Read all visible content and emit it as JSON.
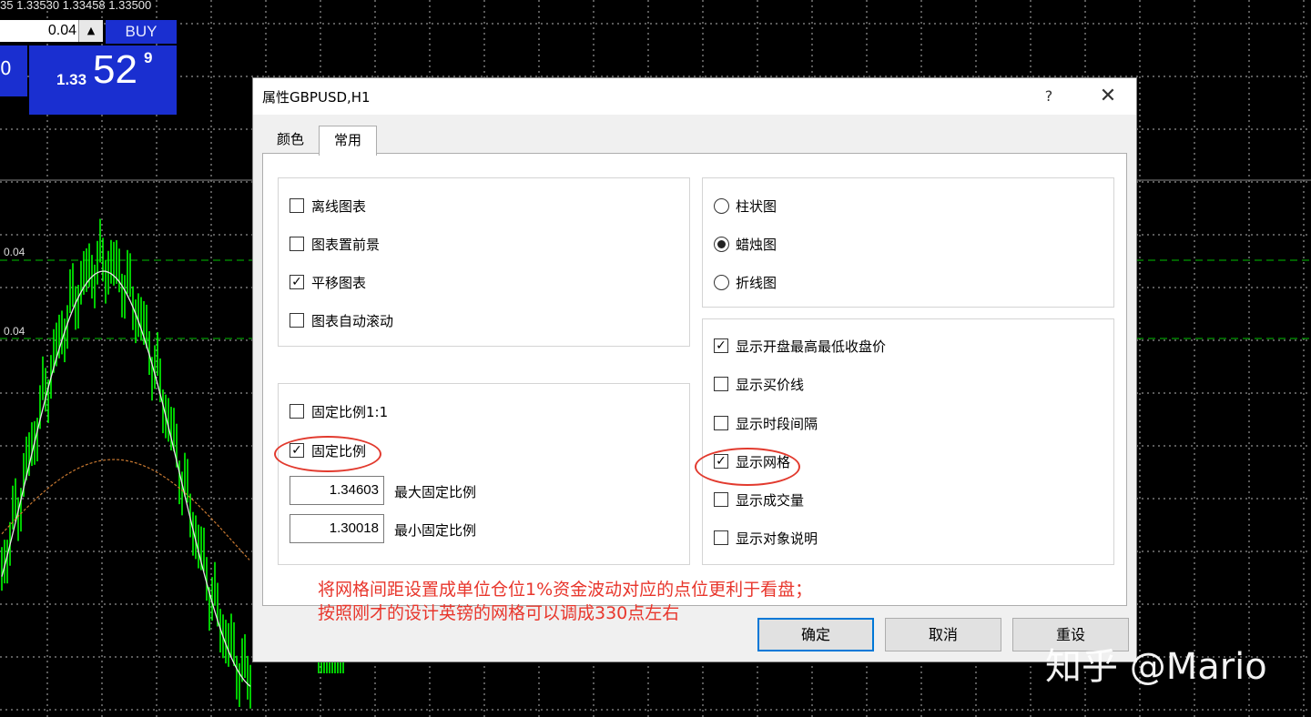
{
  "chart": {
    "quote_line": "35 1.33530 1.33458 1.33500",
    "lot_value": "0.04",
    "spin_glyph": "▲",
    "buy_label": "BUY",
    "price_left": "0",
    "price_small": "1.33",
    "price_big": "52",
    "price_sup": "9",
    "level_labels": [
      "0.04",
      "0.04"
    ],
    "grid_color": "#b4b4b4",
    "candle_color": "#00ff00",
    "level_color": "#00c000"
  },
  "dialog": {
    "title": "属性GBPUSD,H1",
    "help_glyph": "?",
    "close_glyph": "✕",
    "tabs": [
      {
        "label": "颜色",
        "active": false
      },
      {
        "label": "常用",
        "active": true
      }
    ],
    "left_top_group": [
      {
        "label": "离线图表",
        "checked": false
      },
      {
        "label": "图表置前景",
        "checked": false
      },
      {
        "label": "平移图表",
        "checked": true
      },
      {
        "label": "图表自动滚动",
        "checked": false
      }
    ],
    "scale_group": {
      "fixed_ratio_1_1": {
        "label": "固定比例1:1",
        "checked": false
      },
      "fixed_scale": {
        "label": "固定比例",
        "checked": true
      },
      "max_value": "1.34603",
      "max_label": "最大固定比例",
      "min_value": "1.30018",
      "min_label": "最小固定比例"
    },
    "chart_type_group": [
      {
        "label": "柱状图",
        "selected": false
      },
      {
        "label": "蜡烛图",
        "selected": true
      },
      {
        "label": "折线图",
        "selected": false
      }
    ],
    "display_group": [
      {
        "label": "显示开盘最高最低收盘价",
        "checked": true
      },
      {
        "label": "显示买价线",
        "checked": false
      },
      {
        "label": "显示时段间隔",
        "checked": false
      },
      {
        "label": "显示网格",
        "checked": true
      },
      {
        "label": "显示成交量",
        "checked": false
      },
      {
        "label": "显示对象说明",
        "checked": false
      }
    ],
    "check_glyph": "✓",
    "annotation": {
      "line1": "将网格间距设置成单位仓位1%资金波动对应的点位更利于看盘；",
      "line2": "按照刚才的设计英镑的网格可以调成330点左右",
      "color": "#e8362c"
    },
    "buttons": {
      "ok": "确定",
      "cancel": "取消",
      "reset": "重设"
    }
  },
  "watermark": "知乎 @Mario"
}
